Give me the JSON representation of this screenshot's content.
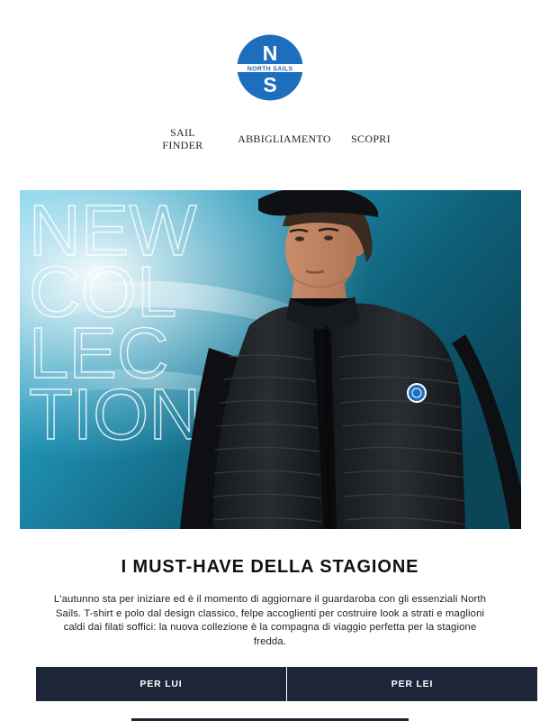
{
  "brand": {
    "logo_letter_top": "N",
    "logo_band_text": "NORTH SAILS",
    "logo_letter_bottom": "S",
    "color_primary": "#1d6fbe",
    "color_navy": "#1d2539"
  },
  "nav": {
    "sail_finder_line1": "SAIL",
    "sail_finder_line2": "FINDER",
    "abbigliamento": "ABBIGLIAMENTO",
    "scopri": "SCOPRI"
  },
  "hero": {
    "overlay_lines": [
      "NEW",
      "COL",
      "LEC",
      "TION"
    ]
  },
  "headline": "I MUST-HAVE DELLA STAGIONE",
  "body_text": "L'autunno sta per iniziare ed è il momento di aggiornare il guardaroba con gli essenziali North Sails. T-shirt e polo dal design classico, felpe accoglienti per costruire look a strati e maglioni caldi dai filati soffici: la nuova collezione è la compagna di viaggio perfetta per la stagione fredda.",
  "buttons": {
    "per_lui": "PER LUI",
    "per_lei": "PER LEI"
  }
}
